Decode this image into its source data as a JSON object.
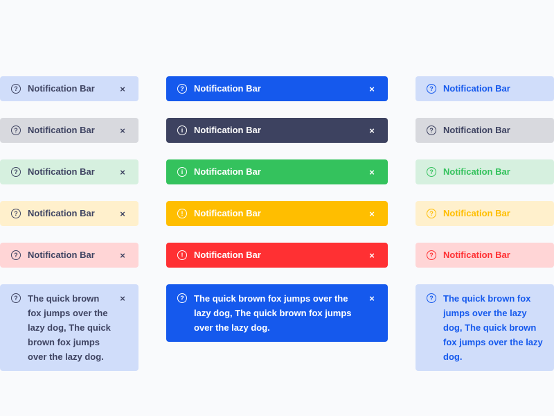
{
  "short_label": "Notification Bar",
  "long_label": "The quick brown fox jumps over the lazy dog, The quick brown fox jumps over the lazy dog.",
  "close_glyph": "×",
  "icons": {
    "question": "?",
    "info": "i",
    "exclamation": "!"
  },
  "rows": [
    {
      "variant": "primary",
      "solid": "#1559ed",
      "light": "#d0ddfa",
      "middle_icon": "question-icon"
    },
    {
      "variant": "dark",
      "solid": "#3d4260",
      "light": "#d8d9de",
      "middle_icon": "info-icon"
    },
    {
      "variant": "success",
      "solid": "#34c25d",
      "light": "#d6f0df",
      "middle_icon": "info-icon"
    },
    {
      "variant": "warning",
      "solid": "#ffbe00",
      "light": "#fff0cc",
      "middle_icon": "exclamation-icon"
    },
    {
      "variant": "danger",
      "solid": "#ff3033",
      "light": "#ffd5d6",
      "middle_icon": "exclamation-icon"
    },
    {
      "variant": "primary-long",
      "solid": "#1559ed",
      "light": "#d0ddfa",
      "middle_icon": "question-icon"
    }
  ],
  "left_text_color": "#3f4462"
}
